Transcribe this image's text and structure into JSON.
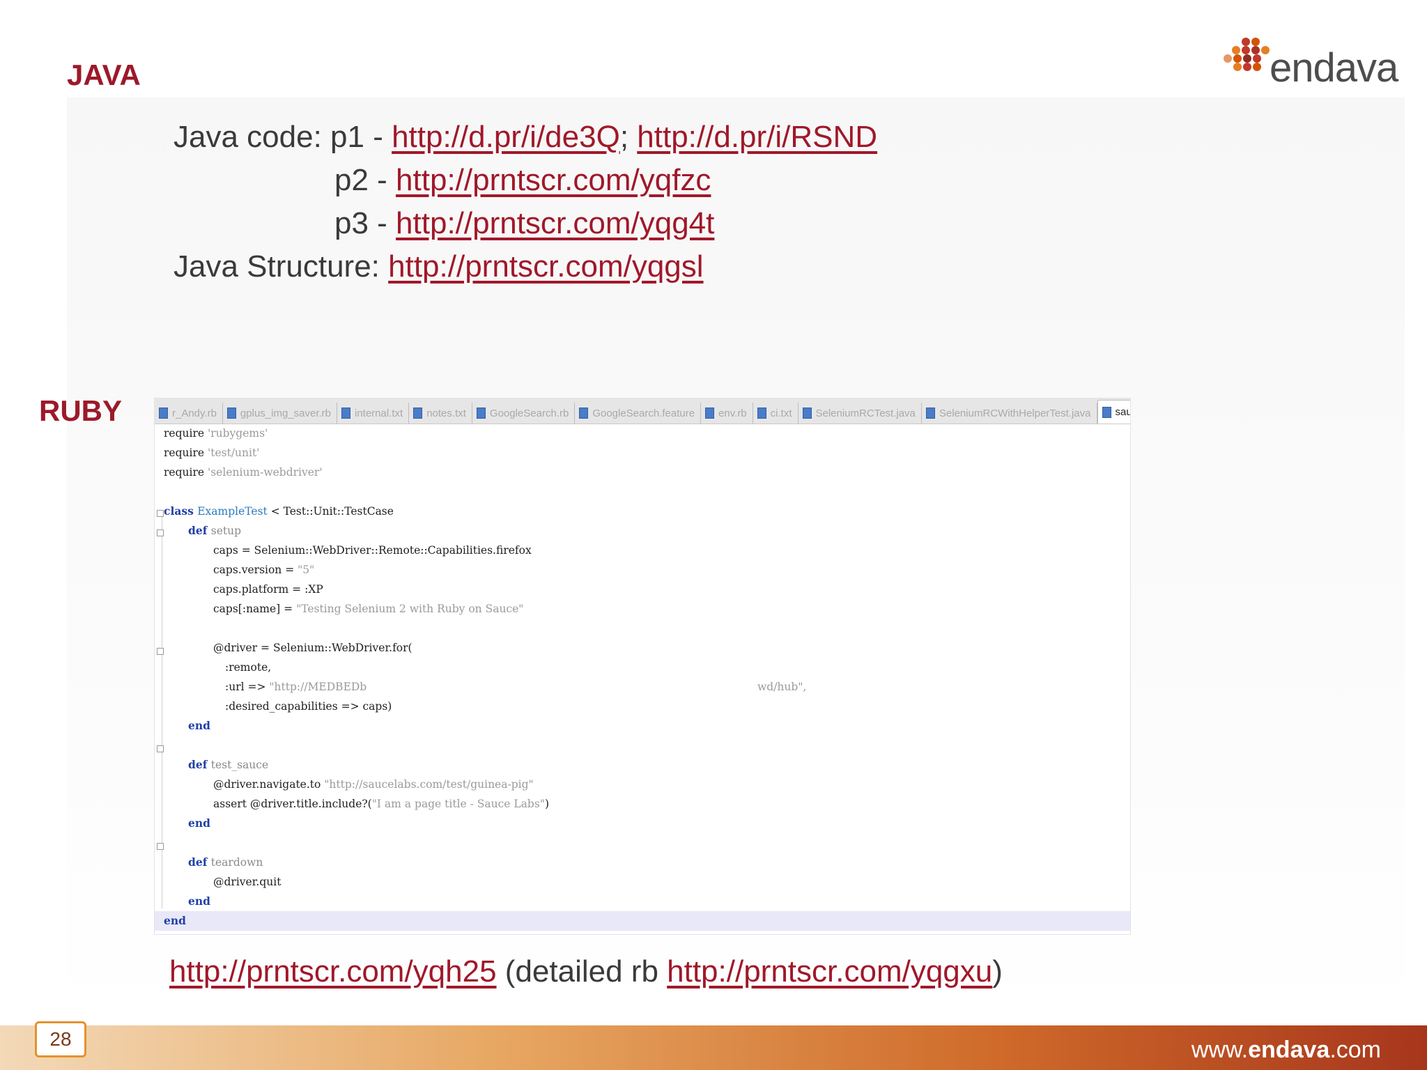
{
  "titles": {
    "java": "JAVA",
    "ruby": "RUBY"
  },
  "logo": {
    "text": "endava",
    "accent_color": "#c0392b"
  },
  "java_links": {
    "line1": {
      "label": "Java code: p1 - ",
      "link1": "http://d.pr/i/de3Q",
      "sep": ";  ",
      "link2": "http://d.pr/i/RSND"
    },
    "line2": {
      "label": "p2 - ",
      "link": "http://prntscr.com/yqfzc"
    },
    "line3": {
      "label": "p3 - ",
      "link": "http://prntscr.com/yqg4t"
    },
    "line4": {
      "label": "Java Structure: ",
      "link": "http://prntscr.com/yqgsl"
    }
  },
  "ide": {
    "tabs": [
      {
        "label": "r_Andy.rb",
        "active": false
      },
      {
        "label": "gplus_img_saver.rb",
        "active": false
      },
      {
        "label": "internal.txt",
        "active": false
      },
      {
        "label": "notes.txt",
        "active": false
      },
      {
        "label": "GoogleSearch.rb",
        "active": false
      },
      {
        "label": "GoogleSearch.feature",
        "active": false
      },
      {
        "label": "env.rb",
        "active": false
      },
      {
        "label": "ci.txt",
        "active": false
      },
      {
        "label": "SeleniumRCTest.java",
        "active": false
      },
      {
        "label": "SeleniumRCWithHelperTest.java",
        "active": false
      },
      {
        "label": "sauce_test.rb",
        "active": true
      }
    ],
    "code": {
      "l1": {
        "a": "require ",
        "b": "'rubygems'"
      },
      "l2": {
        "a": "require ",
        "b": "'test/unit'"
      },
      "l3": {
        "a": "require ",
        "b": "'selenium-webdriver'"
      },
      "l5": {
        "kw": "class ",
        "cls": "ExampleTest",
        "rest": " < Test::Unit::TestCase"
      },
      "l6": {
        "kw": "def ",
        "name": "setup"
      },
      "l7": {
        "text": "caps = Selenium::WebDriver::Remote::Capabilities.firefox"
      },
      "l8": {
        "a": "caps.version = ",
        "b": "\"5\""
      },
      "l9": {
        "text": "caps.platform = :XP"
      },
      "l10": {
        "a": "caps[:name] = ",
        "b": "\"Testing Selenium 2 with Ruby on Sauce\""
      },
      "l12": {
        "text": "@driver = Selenium::WebDriver.for("
      },
      "l13": {
        "text": ":remote,"
      },
      "l14": {
        "a": ":url => ",
        "b": "\"http://MEDBEDb",
        "c": "wd/hub\","
      },
      "l15": {
        "text": ":desired_capabilities => caps)"
      },
      "l16": {
        "kw": "end"
      },
      "l18": {
        "kw": "def ",
        "name": "test_sauce"
      },
      "l19": {
        "a": "@driver.navigate.to ",
        "b": "\"http://saucelabs.com/test/guinea-pig\""
      },
      "l20": {
        "a": "assert @driver.title.include?(",
        "b": "\"I am a page title - Sauce Labs\"",
        "c": ")"
      },
      "l21": {
        "kw": "end"
      },
      "l23": {
        "kw": "def ",
        "name": "teardown"
      },
      "l24": {
        "text": "@driver.quit"
      },
      "l25": {
        "kw": "end"
      },
      "l26": {
        "kw": "end"
      }
    }
  },
  "bottom": {
    "link1": "http://prntscr.com/yqh25",
    "middle": "  (detailed rb ",
    "link2": "http://prntscr.com/yqgxu",
    "close": ")"
  },
  "footer": {
    "url_prefix": "www.",
    "url_brand": "endava",
    "url_suffix": ".com",
    "page_number": "28"
  },
  "colors": {
    "title": "#9b1a2a",
    "link": "#a0182a",
    "footer_start": "#f3d9b8",
    "footer_end": "#a7361c"
  }
}
